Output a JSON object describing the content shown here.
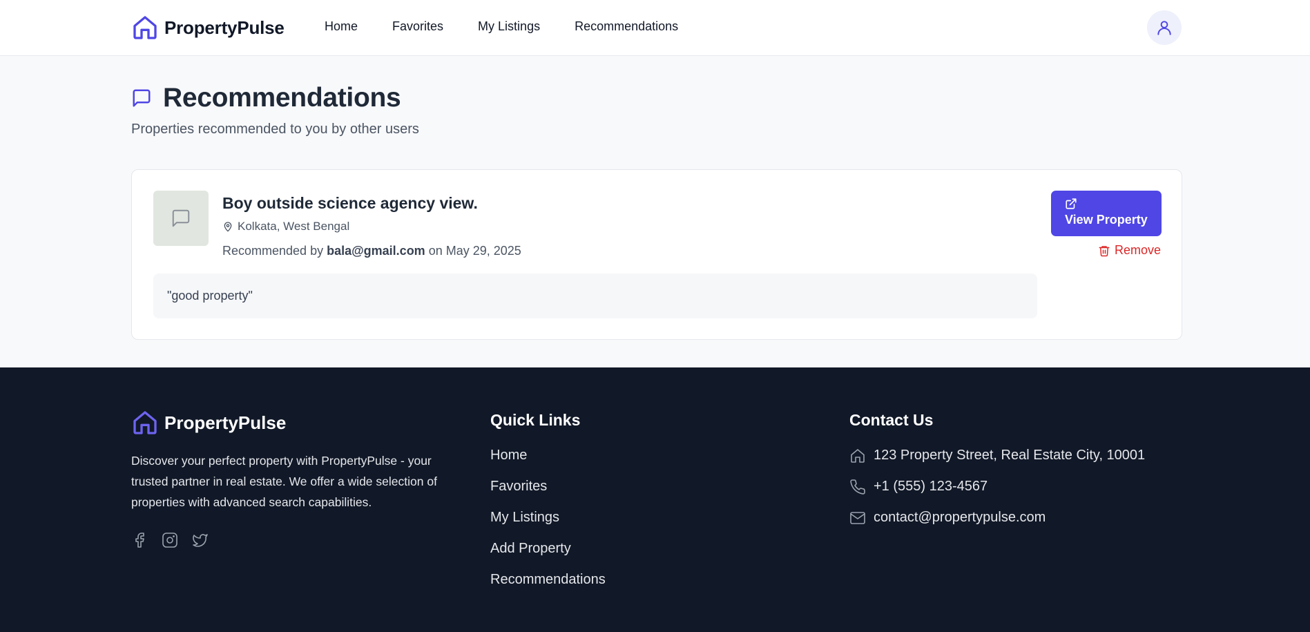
{
  "header": {
    "brand": "PropertyPulse",
    "nav": [
      "Home",
      "Favorites",
      "My Listings",
      "Recommendations"
    ]
  },
  "page": {
    "title": "Recommendations",
    "subtitle": "Properties recommended to you by other users"
  },
  "recommendation": {
    "property_title": "Boy outside science agency view.",
    "location": "Kolkata, West Bengal",
    "recommended_by_prefix": "Recommended by",
    "recommender_email": "bala@gmail.com",
    "date_prefix": "on",
    "date": "May 29, 2025",
    "note": "\"good property\"",
    "view_button": "View Property",
    "remove_button": "Remove"
  },
  "footer": {
    "brand": "PropertyPulse",
    "about": "Discover your perfect property with PropertyPulse - your trusted partner in real estate. We offer a wide selection of properties with advanced search capabilities.",
    "quick_links_title": "Quick Links",
    "quick_links": [
      "Home",
      "Favorites",
      "My Listings",
      "Add Property",
      "Recommendations"
    ],
    "contact_title": "Contact Us",
    "address": "123 Property Street, Real Estate City, 10001",
    "phone": "+1 (555) 123-4567",
    "email": "contact@propertypulse.com",
    "social_icons": [
      "facebook-icon",
      "instagram-icon",
      "twitter-icon"
    ]
  },
  "colors": {
    "accent": "#4f46e5",
    "danger": "#dc2626",
    "footer_bg": "#111827",
    "page_bg": "#f8f9fb"
  }
}
